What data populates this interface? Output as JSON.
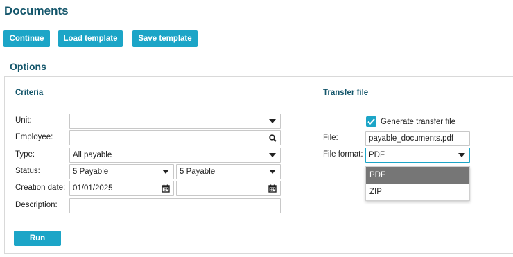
{
  "page": {
    "title": "Documents"
  },
  "toolbar": {
    "continue_label": "Continue",
    "load_template_label": "Load template",
    "save_template_label": "Save template"
  },
  "options": {
    "title": "Options",
    "criteria": {
      "title": "Criteria",
      "unit": {
        "label": "Unit:",
        "value": ""
      },
      "employee": {
        "label": "Employee:",
        "value": ""
      },
      "type": {
        "label": "Type:",
        "value": "All payable"
      },
      "status": {
        "label": "Status:",
        "from": "5 Payable",
        "to": "5 Payable"
      },
      "creation_date": {
        "label": "Creation date:",
        "from": "01/01/2025",
        "to": ""
      },
      "description": {
        "label": "Description:",
        "value": ""
      },
      "run_label": "Run"
    },
    "transfer": {
      "title": "Transfer file",
      "generate_label": "Generate transfer file",
      "generate_checked": true,
      "file": {
        "label": "File:",
        "value": "payable_documents.pdf"
      },
      "file_format": {
        "label": "File format:",
        "value": "PDF",
        "options": [
          "PDF",
          "ZIP"
        ],
        "highlighted": "PDF"
      }
    }
  },
  "colors": {
    "accent": "#1ca5c7",
    "heading": "#14566b",
    "highlight": "#767676"
  }
}
